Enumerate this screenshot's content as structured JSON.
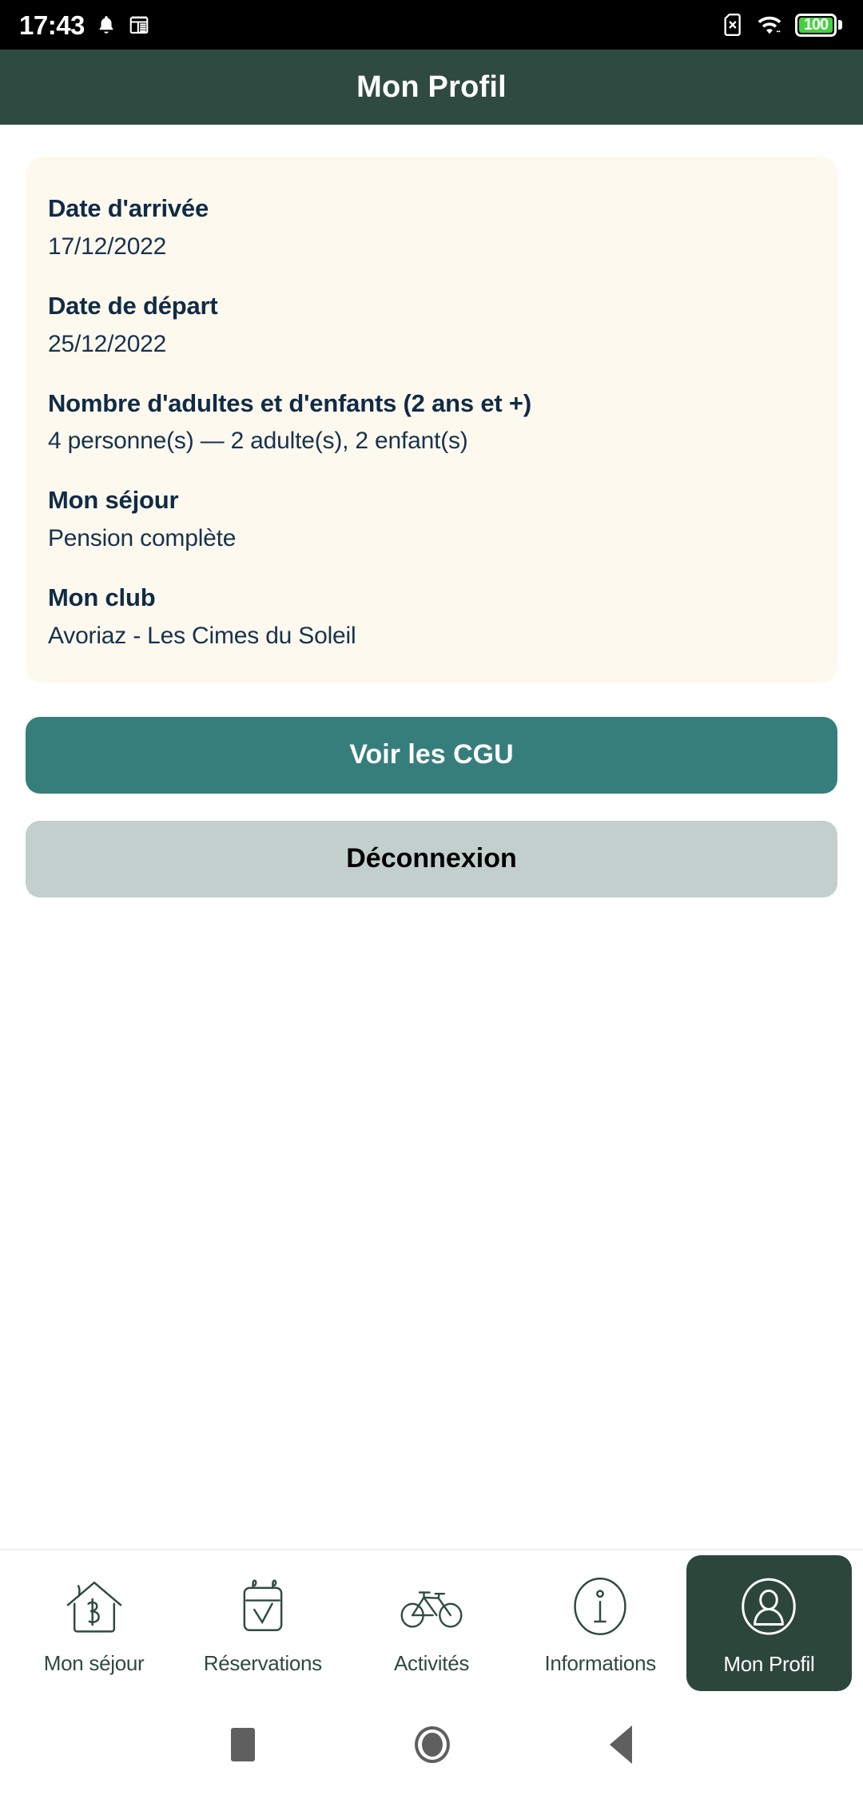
{
  "status_bar": {
    "time": "17:43",
    "notification_icon": "bell-icon",
    "calendar_icon": "calendar-icon",
    "sim_icon": "sim-card-off-icon",
    "wifi_icon": "wifi-icon",
    "battery_level": "100",
    "battery_color": "#43d13d"
  },
  "header": {
    "title": "Mon Profil",
    "background": "#2F4A41"
  },
  "card": {
    "background": "#FDF9EE",
    "fields": [
      {
        "label": "Date d'arrivée",
        "value": "17/12/2022"
      },
      {
        "label": "Date de départ",
        "value": "25/12/2022"
      },
      {
        "label": "Nombre d'adultes et d'enfants (2 ans et +)",
        "value": "4 personne(s) — 2 adulte(s), 2 enfant(s)"
      },
      {
        "label": "Mon séjour",
        "value": "Pension complète"
      },
      {
        "label": "Mon club",
        "value": "Avoriaz - Les Cimes du Soleil"
      }
    ]
  },
  "actions": {
    "primary_label": "Voir les CGU",
    "primary_color": "#367E7C",
    "secondary_label": "Déconnexion",
    "secondary_color": "#C3CFCC"
  },
  "bottom_nav": {
    "active_color": "#2C463C",
    "items": [
      {
        "label": "Mon séjour",
        "icon": "house-b-icon",
        "active": false
      },
      {
        "label": "Réservations",
        "icon": "calendar-check-icon",
        "active": false
      },
      {
        "label": "Activités",
        "icon": "bicycle-icon",
        "active": false
      },
      {
        "label": "Informations",
        "icon": "info-circle-icon",
        "active": false
      },
      {
        "label": "Mon Profil",
        "icon": "person-circle-icon",
        "active": true
      }
    ]
  },
  "android_nav": {
    "recents": "square-icon",
    "home": "circle-icon",
    "back": "triangle-back-icon"
  }
}
